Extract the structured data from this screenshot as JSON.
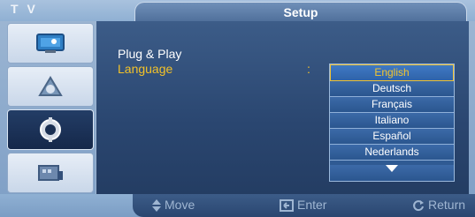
{
  "header": {
    "tv_label": "T V",
    "title": "Setup"
  },
  "sidebar": {
    "items": [
      {
        "icon": "picture-icon",
        "active": false
      },
      {
        "icon": "sound-icon",
        "active": false
      },
      {
        "icon": "setup-gear-icon",
        "active": true
      },
      {
        "icon": "input-icon",
        "active": false
      }
    ]
  },
  "menu": {
    "plug_and_play": "Plug & Play",
    "language_label": "Language",
    "colon": ":"
  },
  "language_dropdown": {
    "selected": "English",
    "options": [
      "English",
      "Deutsch",
      "Français",
      "Italiano",
      "Español",
      "Nederlands"
    ]
  },
  "footer": {
    "move": "Move",
    "enter": "Enter",
    "return": "Return"
  },
  "colors": {
    "highlight": "#f2c229",
    "panel": "#2a4670"
  }
}
